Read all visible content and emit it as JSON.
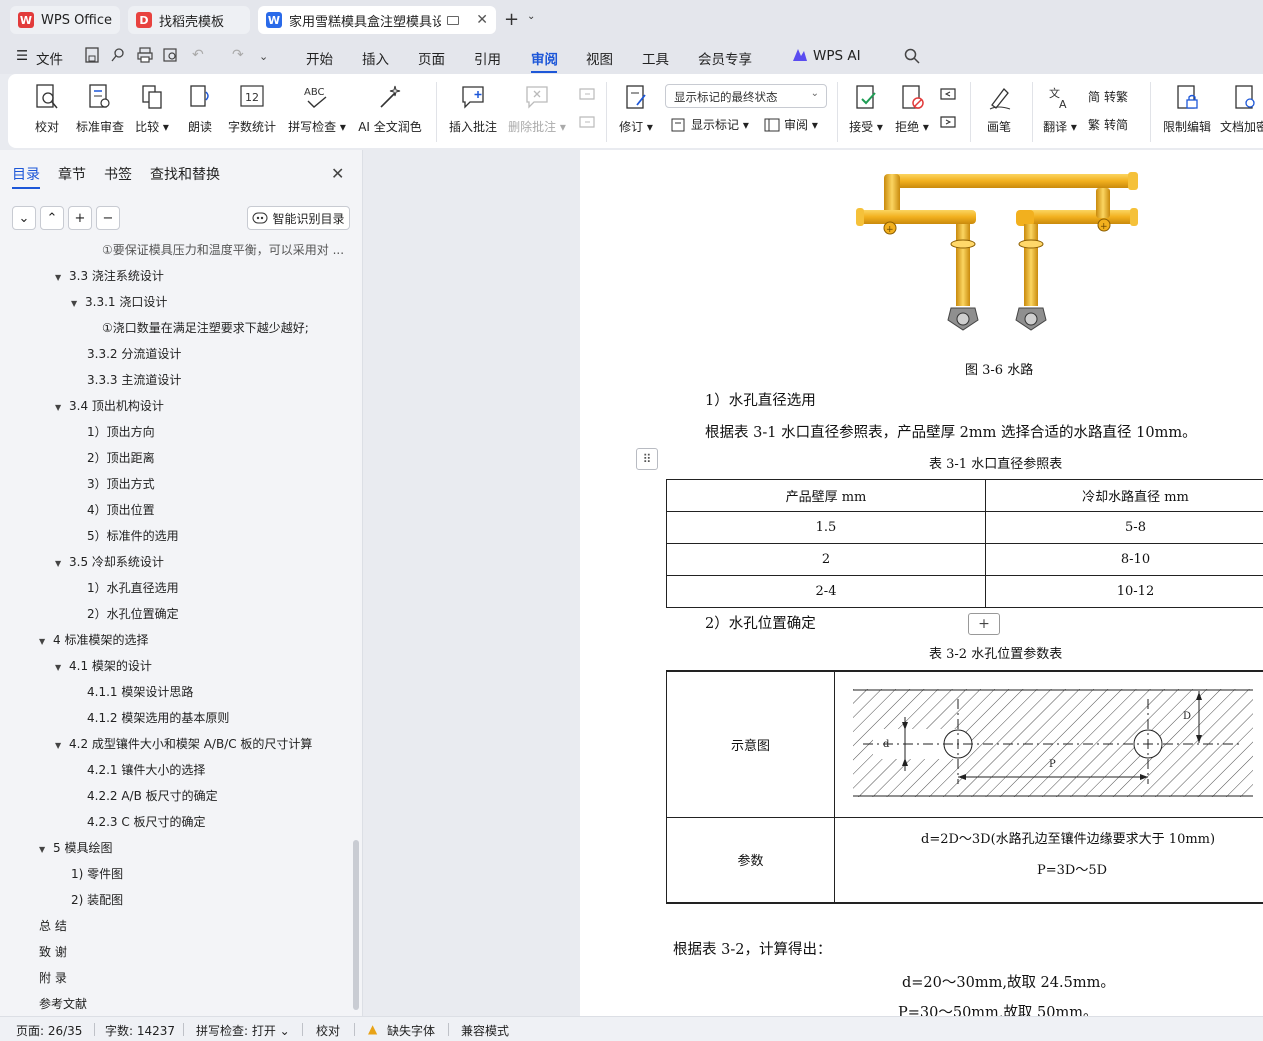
{
  "tabs": [
    {
      "label": "WPS Office",
      "icon": "wps-logo-icon",
      "color": "#e23b3b"
    },
    {
      "label": "找稻壳模板",
      "icon": "docer-icon",
      "color": "#e8423f"
    },
    {
      "label": "家用雪糕模具盒注塑模具设计",
      "icon": "word-doc-icon",
      "color": "#2a6ae9"
    }
  ],
  "menu": {
    "file": "文件",
    "items": [
      "开始",
      "插入",
      "页面",
      "引用",
      "审阅",
      "视图",
      "工具",
      "会员专享"
    ],
    "active": "审阅",
    "ai": "WPS AI"
  },
  "ribbon": {
    "proofread": "校对",
    "standard_review": "标准审查",
    "compare": "比较",
    "read_aloud": "朗读",
    "word_count": "字数统计",
    "spell_check": "拼写检查",
    "ai_proofread": "AI 全文润色",
    "insert_comment": "插入批注",
    "delete_comment": "删除批注",
    "track_changes": "修订",
    "markup_state": "显示标记的最终状态",
    "show_markup": "显示标记",
    "review": "审阅",
    "accept": "接受",
    "reject": "拒绝",
    "pen": "画笔",
    "translate": "翻译",
    "to_traditional": "转繁",
    "to_simplified": "转简",
    "restrict_edit": "限制编辑",
    "doc_encrypt": "文档加密",
    "abc": "ABC",
    "digits": "12"
  },
  "left_panel": {
    "tabs": [
      "目录",
      "章节",
      "书签",
      "查找和替换"
    ],
    "active": "目录",
    "smart_toc": "智能识别目录",
    "toc": [
      {
        "text": "①要保证模具压力和温度平衡，可以采用对 ...",
        "arrow": false
      },
      {
        "text": "3.3  浇注系统设计",
        "arrow": true
      },
      {
        "text": "3.3.1  浇口设计",
        "arrow": true
      },
      {
        "text": "①浇口数量在满足注塑要求下越少越好;",
        "arrow": false
      },
      {
        "text": "3.3.2  分流道设计",
        "arrow": false
      },
      {
        "text": "3.3.3  主流道设计",
        "arrow": false
      },
      {
        "text": "3.4  顶出机构设计",
        "arrow": true
      },
      {
        "text": "1）顶出方向",
        "arrow": false
      },
      {
        "text": "2）顶出距离",
        "arrow": false
      },
      {
        "text": "3）顶出方式",
        "arrow": false
      },
      {
        "text": "4）顶出位置",
        "arrow": false
      },
      {
        "text": "5）标准件的选用",
        "arrow": false
      },
      {
        "text": "3.5  冷却系统设计",
        "arrow": true
      },
      {
        "text": "1）水孔直径选用",
        "arrow": false
      },
      {
        "text": "2）水孔位置确定",
        "arrow": false
      },
      {
        "text": "4  标准模架的选择",
        "arrow": true
      },
      {
        "text": "4.1 模架的设计",
        "arrow": true
      },
      {
        "text": "4.1.1  模架设计思路",
        "arrow": false
      },
      {
        "text": "4.1.2  模架选用的基本原则",
        "arrow": false
      },
      {
        "text": "4.2  成型镶件大小和模架 A/B/C 板的尺寸计算",
        "arrow": true
      },
      {
        "text": "4.2.1  镶件大小的选择",
        "arrow": false
      },
      {
        "text": "4.2.2    A/B 板尺寸的确定",
        "arrow": false
      },
      {
        "text": "4.2.3    C 板尺寸的确定",
        "arrow": false
      },
      {
        "text": "5  模具绘图",
        "arrow": true
      },
      {
        "text": "1)    零件图",
        "arrow": false
      },
      {
        "text": "2)    装配图",
        "arrow": false
      },
      {
        "text": "总 结",
        "arrow": false
      },
      {
        "text": "致 谢",
        "arrow": false
      },
      {
        "text": "附 录",
        "arrow": false
      },
      {
        "text": "参考文献",
        "arrow": false
      }
    ]
  },
  "document": {
    "fig_caption": "图 3-6 水路",
    "sec1_heading": "1）水孔直径选用",
    "sec1_body": "根据表 3-1 水口直径参照表，产品壁厚 2mm 选择合适的水路直径 10mm。",
    "table1_caption": "表 3-1 水口直径参照表",
    "table1_header": [
      "产品壁厚 mm",
      "冷却水路直径 mm"
    ],
    "table1_rows": [
      [
        "1.5",
        "5-8"
      ],
      [
        "2",
        "8-10"
      ],
      [
        "2-4",
        "10-12"
      ]
    ],
    "sec2_heading": "2）水孔位置确定",
    "table2_caption": "表 3-2 水孔位置参数表",
    "table2_label1": "示意图",
    "table2_label2": "参数",
    "table2_param1": "d=2D～3D(水路孔边至镶件边缘要求大于 10mm)",
    "table2_param2": "P=3D～5D",
    "diagram_letters": [
      "d",
      "D",
      "P"
    ],
    "calc_intro": "根据表 3-2，计算得出：",
    "calc1": "d=20～30mm,故取 24.5mm。",
    "calc2": "P=30～50mm,故取 50mm。"
  },
  "status": {
    "page": "页面: 26/35",
    "words": "字数: 14237",
    "spell": "拼写检查: 打开",
    "proofread": "校对",
    "missing_font": "缺失字体",
    "compat": "兼容模式"
  },
  "colors": {
    "accent": "#1d57d8",
    "pipe": "#f2b01e",
    "warning": "#e8a317"
  }
}
